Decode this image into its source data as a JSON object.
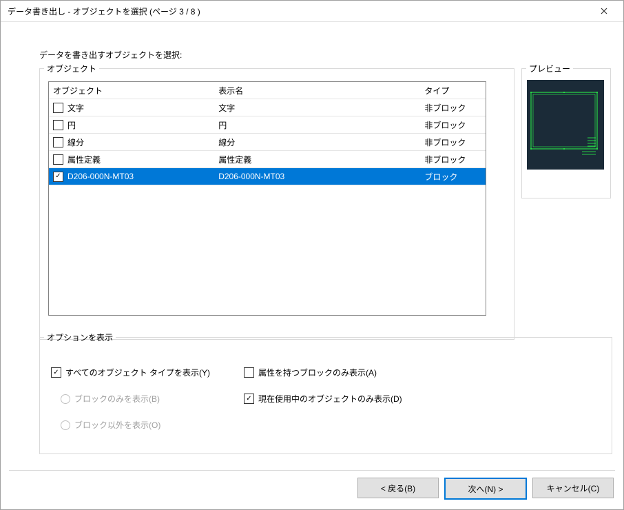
{
  "window": {
    "title": "データ書き出し - オブジェクトを選択 (ページ 3 / 8 )"
  },
  "labels": {
    "select_objects": "データを書き出すオブジェクトを選択:",
    "objects_group": "オブジェクト",
    "preview_group": "プレビュー",
    "options_group": "オプションを表示"
  },
  "columns": {
    "object": "オブジェクト",
    "display_name": "表示名",
    "type": "タイプ"
  },
  "rows": [
    {
      "checked": false,
      "object": "文字",
      "display": "文字",
      "type": "非ブロック",
      "selected": false
    },
    {
      "checked": false,
      "object": "円",
      "display": "円",
      "type": "非ブロック",
      "selected": false
    },
    {
      "checked": false,
      "object": "線分",
      "display": "線分",
      "type": "非ブロック",
      "selected": false
    },
    {
      "checked": false,
      "object": "属性定義",
      "display": "属性定義",
      "type": "非ブロック",
      "selected": false
    },
    {
      "checked": true,
      "object": "D206-000N-MT03",
      "display": "D206-000N-MT03",
      "type": "ブロック",
      "selected": true
    }
  ],
  "options": {
    "show_all_types": {
      "label": "すべてのオブジェクト タイプを表示(Y)",
      "checked": true
    },
    "blocks_only": {
      "label": "ブロックのみを表示(B)"
    },
    "non_blocks_only": {
      "label": "ブロック以外を表示(O)"
    },
    "attr_blocks_only": {
      "label": "属性を持つブロックのみ表示(A)",
      "checked": false
    },
    "in_use_only": {
      "label": "現在使用中のオブジェクトのみ表示(D)",
      "checked": true
    }
  },
  "buttons": {
    "back": "< 戻る(B)",
    "next": "次へ(N) >",
    "cancel": "キャンセル(C)"
  },
  "glyphs": {
    "check": "✓"
  }
}
